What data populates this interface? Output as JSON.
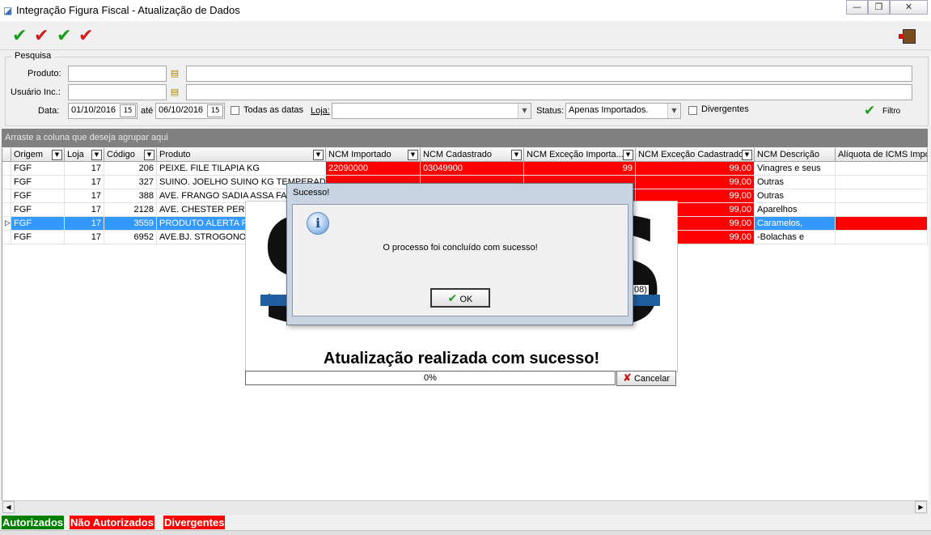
{
  "window": {
    "title": "Integração Figura Fiscal - Atualização de Dados",
    "minimize": "—",
    "restore": "❐",
    "close": "✕"
  },
  "toolbar": {
    "icons": [
      "check-green",
      "check-red",
      "check-green",
      "check-red"
    ],
    "exit_icon": "door-exit-icon"
  },
  "search": {
    "group_title": "Pesquisa",
    "produto_label": "Produto:",
    "produto_value": "",
    "usuario_label": "Usuário Inc.:",
    "usuario_value": "",
    "data_label": "Data:",
    "date_from": "01/10/2016",
    "ate_label": "até",
    "date_to": "06/10/2016",
    "cal_glyph": "15",
    "todas_label": "Todas as datas",
    "loja_label": "Loja:",
    "loja_value": "",
    "status_label": "Status:",
    "status_value": "Apenas Importados.",
    "divergentes_label": "Divergentes",
    "filtro_label": "Filtro"
  },
  "grid": {
    "group_hint": "Arraste a coluna que deseja agrupar aqui",
    "columns": [
      "Origem",
      "Loja",
      "Código",
      "Produto",
      "NCM Importado",
      "NCM Cadastrado",
      "NCM Exceção Importa...",
      "NCM Exceção Cadastrado",
      "NCM Descrição",
      "Alíquota de ICMS Impo"
    ],
    "rows": [
      {
        "origem": "FGF",
        "loja": "17",
        "codigo": "206",
        "produto": "PEIXE. FILE TILAPIA KG",
        "ncm_imp": "22090000",
        "ncm_cad": "03049900",
        "exc_imp": "99",
        "exc_cad": "99,00",
        "descricao": "Vinagres e seus"
      },
      {
        "origem": "FGF",
        "loja": "17",
        "codigo": "327",
        "produto": "SUINO. JOELHO SUINO KG TEMPERADO",
        "ncm_imp": "",
        "ncm_cad": "",
        "exc_imp": "",
        "exc_cad": "99,00",
        "descricao": "Outras"
      },
      {
        "origem": "FGF",
        "loja": "17",
        "codigo": "388",
        "produto": "AVE. FRANGO SADIA ASSA FACIL",
        "ncm_imp": "",
        "ncm_cad": "",
        "exc_imp": "",
        "exc_cad": "99,00",
        "descricao": "Outras"
      },
      {
        "origem": "FGF",
        "loja": "17",
        "codigo": "2128",
        "produto": "AVE. CHESTER PERDIGAO",
        "ncm_imp": "",
        "ncm_cad": "",
        "exc_imp": "",
        "exc_cad": "99,00",
        "descricao": "Aparelhos"
      },
      {
        "origem": "FGF",
        "loja": "17",
        "codigo": "3559",
        "produto": "PRODUTO ALERTA R",
        "ncm_imp": "",
        "ncm_cad": "",
        "exc_imp": "",
        "exc_cad": "99,00",
        "descricao": "Caramelos,"
      },
      {
        "origem": "FGF",
        "loja": "17",
        "codigo": "6952",
        "produto": "AVE.BJ. STROGONOFF",
        "ncm_imp": "",
        "ncm_cad": "",
        "exc_imp": "",
        "exc_cad": "99,00",
        "descricao": "-Bolachas e"
      }
    ]
  },
  "splash": {
    "logo_letter_left": "S",
    "logo_letter_right": "S",
    "logo_suffix": "08)",
    "message": "Atualização realizada com sucesso!",
    "progress": "0%",
    "cancel_label": "Cancelar"
  },
  "dialog": {
    "title": "Sucesso!",
    "message": "O processo foi concluído com sucesso!",
    "ok_label": "OK"
  },
  "legend": {
    "autorizados": "Autorizados",
    "nao_autorizados": "Não Autorizados",
    "divergentes": "Divergentes"
  },
  "colors": {
    "green": "#008000",
    "red": "#ff0000",
    "selection": "#3399ff"
  }
}
